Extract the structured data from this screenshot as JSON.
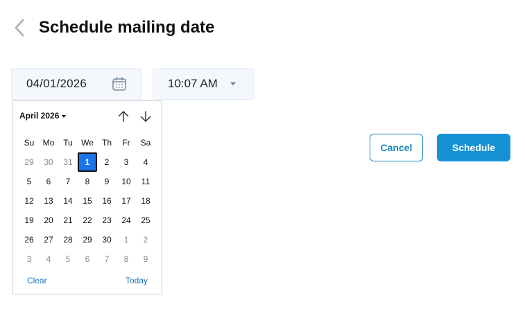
{
  "header": {
    "title": "Schedule mailing date",
    "back_icon": "chevron-left-icon"
  },
  "date_field": {
    "value": "04/01/2026",
    "icon": "calendar-icon"
  },
  "time_field": {
    "value": "10:07 AM",
    "icon": "caret-down-icon"
  },
  "datepicker": {
    "month_label": "April 2026",
    "prev_icon": "arrow-up-icon",
    "next_icon": "arrow-down-icon",
    "weekdays": [
      "Su",
      "Mo",
      "Tu",
      "We",
      "Th",
      "Fr",
      "Sa"
    ],
    "days": [
      {
        "label": "29",
        "other": true
      },
      {
        "label": "30",
        "other": true
      },
      {
        "label": "31",
        "other": true
      },
      {
        "label": "1",
        "selected": true
      },
      {
        "label": "2"
      },
      {
        "label": "3"
      },
      {
        "label": "4"
      },
      {
        "label": "5"
      },
      {
        "label": "6"
      },
      {
        "label": "7"
      },
      {
        "label": "8"
      },
      {
        "label": "9"
      },
      {
        "label": "10"
      },
      {
        "label": "11"
      },
      {
        "label": "12"
      },
      {
        "label": "13"
      },
      {
        "label": "14"
      },
      {
        "label": "15"
      },
      {
        "label": "16"
      },
      {
        "label": "17"
      },
      {
        "label": "18"
      },
      {
        "label": "19"
      },
      {
        "label": "20"
      },
      {
        "label": "21"
      },
      {
        "label": "22"
      },
      {
        "label": "23"
      },
      {
        "label": "24"
      },
      {
        "label": "25"
      },
      {
        "label": "26"
      },
      {
        "label": "27"
      },
      {
        "label": "28"
      },
      {
        "label": "29"
      },
      {
        "label": "30"
      },
      {
        "label": "1",
        "other": true
      },
      {
        "label": "2",
        "other": true
      },
      {
        "label": "3",
        "other": true
      },
      {
        "label": "4",
        "other": true
      },
      {
        "label": "5",
        "other": true
      },
      {
        "label": "6",
        "other": true
      },
      {
        "label": "7",
        "other": true
      },
      {
        "label": "8",
        "other": true
      },
      {
        "label": "9",
        "other": true
      }
    ],
    "clear_label": "Clear",
    "today_label": "Today"
  },
  "actions": {
    "cancel_label": "Cancel",
    "schedule_label": "Schedule"
  },
  "colors": {
    "accent": "#1791d6",
    "selected_day": "#1a73e8",
    "link": "#1573c2"
  }
}
